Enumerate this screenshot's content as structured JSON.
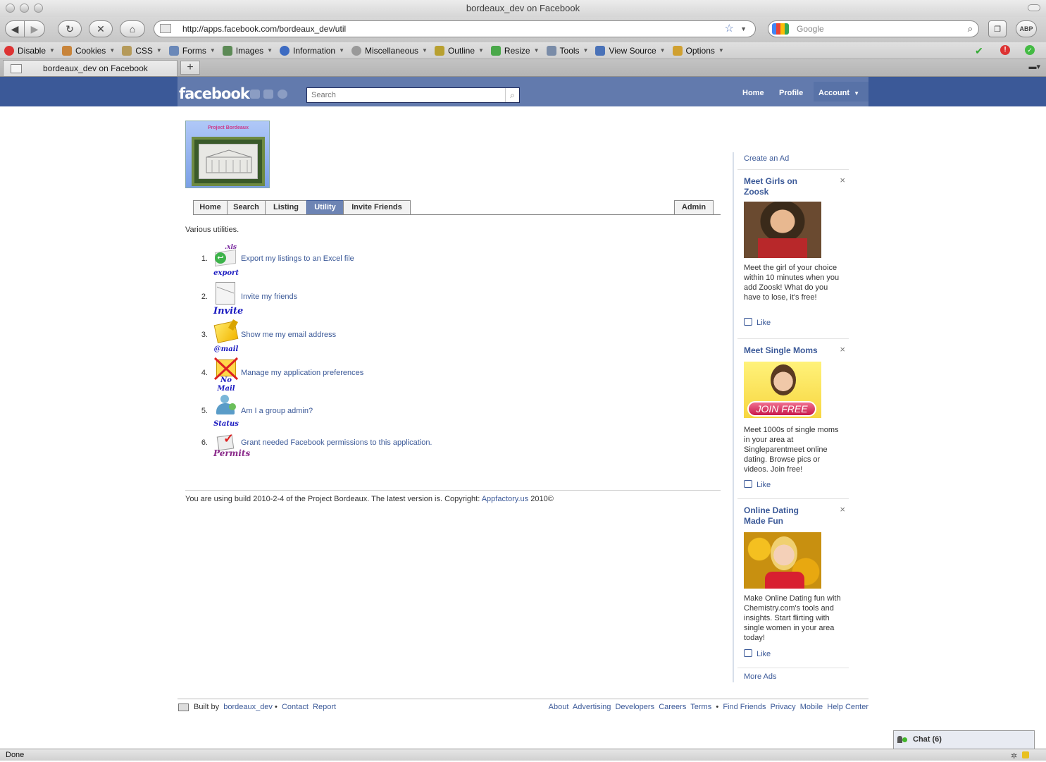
{
  "window": {
    "title": "bordeaux_dev on Facebook"
  },
  "browser": {
    "url": "http://apps.facebook.com/bordeaux_dev/util",
    "search_placeholder": "Google",
    "abp_label": "ABP",
    "toolbar": [
      {
        "label": "Disable",
        "icon": "no-entry-icon",
        "color": "#d33"
      },
      {
        "label": "Cookies",
        "icon": "cookie-person-icon",
        "color": "#c8843a"
      },
      {
        "label": "CSS",
        "icon": "css-icon",
        "color": "#b59a5a"
      },
      {
        "label": "Forms",
        "icon": "form-icon",
        "color": "#6a88b8"
      },
      {
        "label": "Images",
        "icon": "image-icon",
        "color": "#5c8a56"
      },
      {
        "label": "Information",
        "icon": "info-icon",
        "color": "#3d6bc2"
      },
      {
        "label": "Miscellaneous",
        "icon": "gear-icon",
        "color": "#888"
      },
      {
        "label": "Outline",
        "icon": "pencil-icon",
        "color": "#b8a030"
      },
      {
        "label": "Resize",
        "icon": "resize-icon",
        "color": "#4aa84a"
      },
      {
        "label": "Tools",
        "icon": "wrench-icon",
        "color": "#7a8ca8"
      },
      {
        "label": "View Source",
        "icon": "source-icon",
        "color": "#4a72b8"
      },
      {
        "label": "Options",
        "icon": "options-icon",
        "color": "#d0a030"
      }
    ],
    "tab_title": "bordeaux_dev on Facebook",
    "status": "Done"
  },
  "fb": {
    "logo": "facebook",
    "search_placeholder": "Search",
    "nav": {
      "home": "Home",
      "profile": "Profile",
      "account": "Account"
    }
  },
  "app": {
    "logo_caption": "Project Bordeaux",
    "tabs": [
      "Home",
      "Search",
      "Listing",
      "Utility",
      "Invite Friends"
    ],
    "admin_tab": "Admin",
    "selected_tab": "Utility",
    "description": "Various utilities.",
    "utilities": [
      {
        "num": "1.",
        "label": "Export my listings to an Excel file",
        "icon": "export-excel-icon",
        "icon_caption": "export",
        "icon_top": ".xls"
      },
      {
        "num": "2.",
        "label": "Invite my friends",
        "icon": "invite-envelope-icon",
        "icon_caption": "Invite"
      },
      {
        "num": "3.",
        "label": "Show me my email address",
        "icon": "email-envelope-icon",
        "icon_caption": "@mail"
      },
      {
        "num": "4.",
        "label": "Manage my application preferences",
        "icon": "no-mail-icon",
        "icon_caption": "No Mail"
      },
      {
        "num": "5.",
        "label": "Am I a group admin?",
        "icon": "group-status-icon",
        "icon_caption": "Status"
      },
      {
        "num": "6.",
        "label": "Grant needed Facebook permissions to this application.",
        "icon": "permits-checklist-icon",
        "icon_caption": "Permits"
      }
    ],
    "build_text": "You are using build 2010-2-4 of the Project Bordeaux. The latest version is. Copyright:",
    "build_link": "Appfactory.us",
    "build_suffix": "2010©"
  },
  "ads": {
    "create": "Create an Ad",
    "more": "More Ads",
    "items": [
      {
        "title": "Meet Girls on Zoosk",
        "body": "Meet the girl of your choice within 10 minutes when you add Zoosk! What do you have to lose, it's free!",
        "like": "Like",
        "close": "×"
      },
      {
        "title": "Meet Single Moms",
        "body": "Meet 1000s of single moms in your area at Singleparentmeet online dating. Browse pics or videos. Join free!",
        "like": "Like",
        "close": "×",
        "image_button": "JOIN FREE"
      },
      {
        "title": "Online Dating Made Fun",
        "body": "Make Online Dating fun with Chemistry.com's tools and insights. Start flirting with single women in your area today!",
        "like": "Like",
        "close": "×"
      }
    ]
  },
  "footer": {
    "built_by": "Built by",
    "app_name": "bordeaux_dev",
    "dot": "•",
    "contact": "Contact",
    "report": "Report",
    "links": [
      "About",
      "Advertising",
      "Developers",
      "Careers",
      "Terms",
      "•",
      "Find Friends",
      "Privacy",
      "Mobile",
      "Help Center"
    ]
  },
  "chat": {
    "label": "Chat (6)"
  }
}
